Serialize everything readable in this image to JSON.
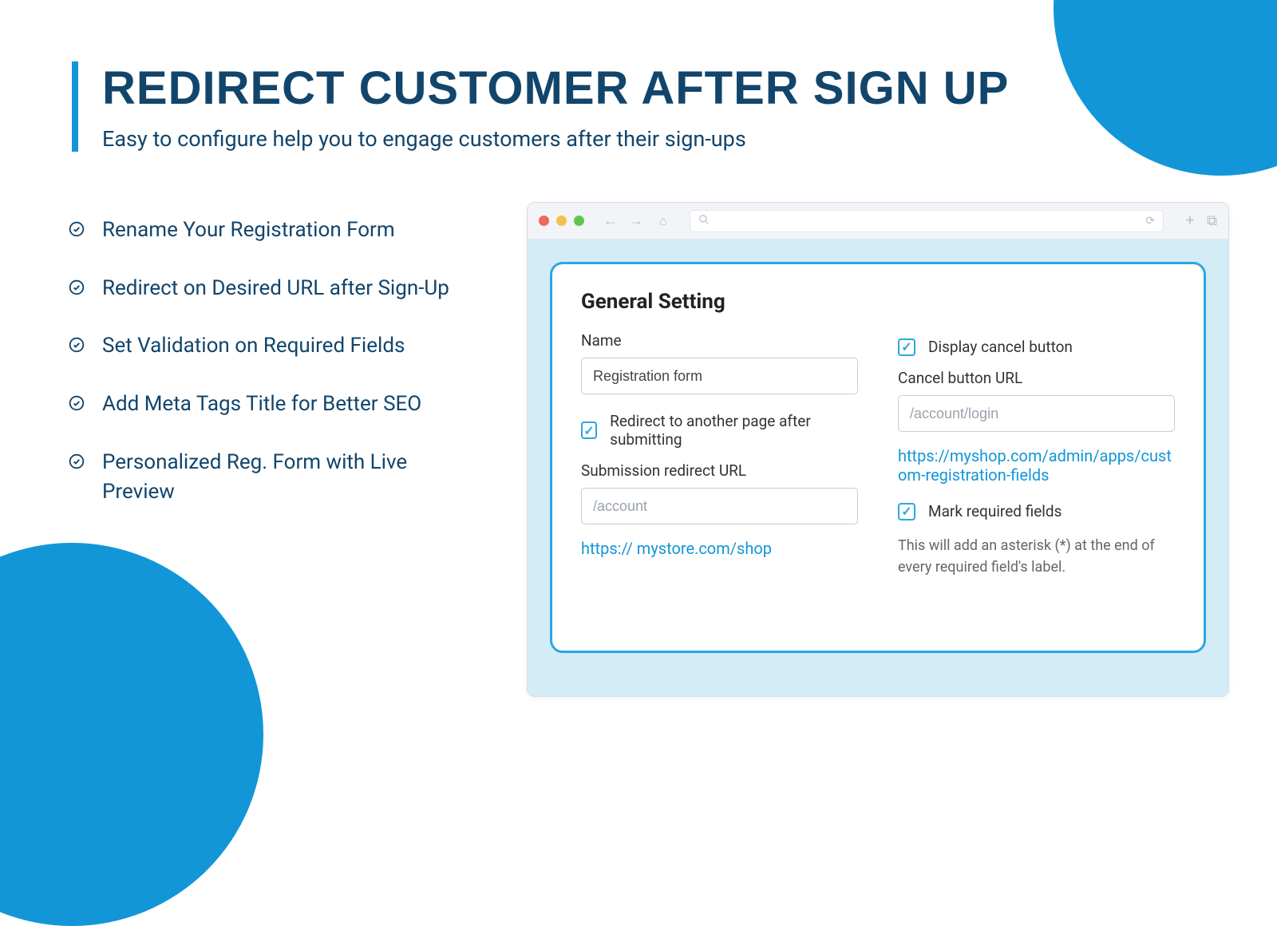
{
  "heading": {
    "title": "REDIRECT CUSTOMER AFTER SIGN UP",
    "subtitle": "Easy to configure help you to engage customers after their sign-ups"
  },
  "features": [
    "Rename Your Registration Form",
    "Redirect on Desired URL after Sign-Up",
    "Set Validation on Required Fields",
    "Add Meta Tags Title for Better SEO",
    "Personalized Reg. Form with Live Preview"
  ],
  "card": {
    "title": "General Setting",
    "left": {
      "name_label": "Name",
      "name_value": "Registration form",
      "redirect_checkbox_label": "Redirect to another page after submitting",
      "submission_label": "Submission redirect URL",
      "submission_placeholder": "/account",
      "store_link": "https:// mystore.com/shop"
    },
    "right": {
      "display_cancel_label": "Display cancel button",
      "cancel_url_label": "Cancel button URL",
      "cancel_url_placeholder": "/account/login",
      "admin_link": "https://myshop.com/admin/apps/custom-registration-fields",
      "mark_required_label": "Mark required fields",
      "help_text": "This will add an asterisk (*) at the end of every required field's label."
    }
  }
}
